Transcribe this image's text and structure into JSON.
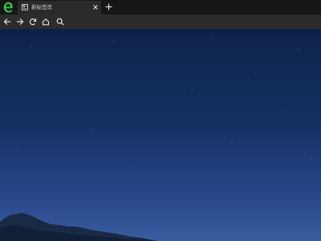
{
  "browser": {
    "logo_icon": "edge-e-logo-icon",
    "tab": {
      "title": "新标签页",
      "icon": "new-tab-page-icon",
      "close_icon": "close-icon"
    },
    "new_tab_icon": "plus-icon"
  },
  "toolbar": {
    "icons": [
      "back-arrow-icon",
      "forward-arrow-icon",
      "refresh-icon",
      "home-icon",
      "search-icon"
    ]
  },
  "colors": {
    "tabbar": "#161616",
    "active_tab": "#2a2a2a",
    "toolbar": "#2c2c2c",
    "logo_green": "#2ed14a",
    "sky_top": "#0d2249",
    "sky_bottom": "#3a5ca0"
  }
}
